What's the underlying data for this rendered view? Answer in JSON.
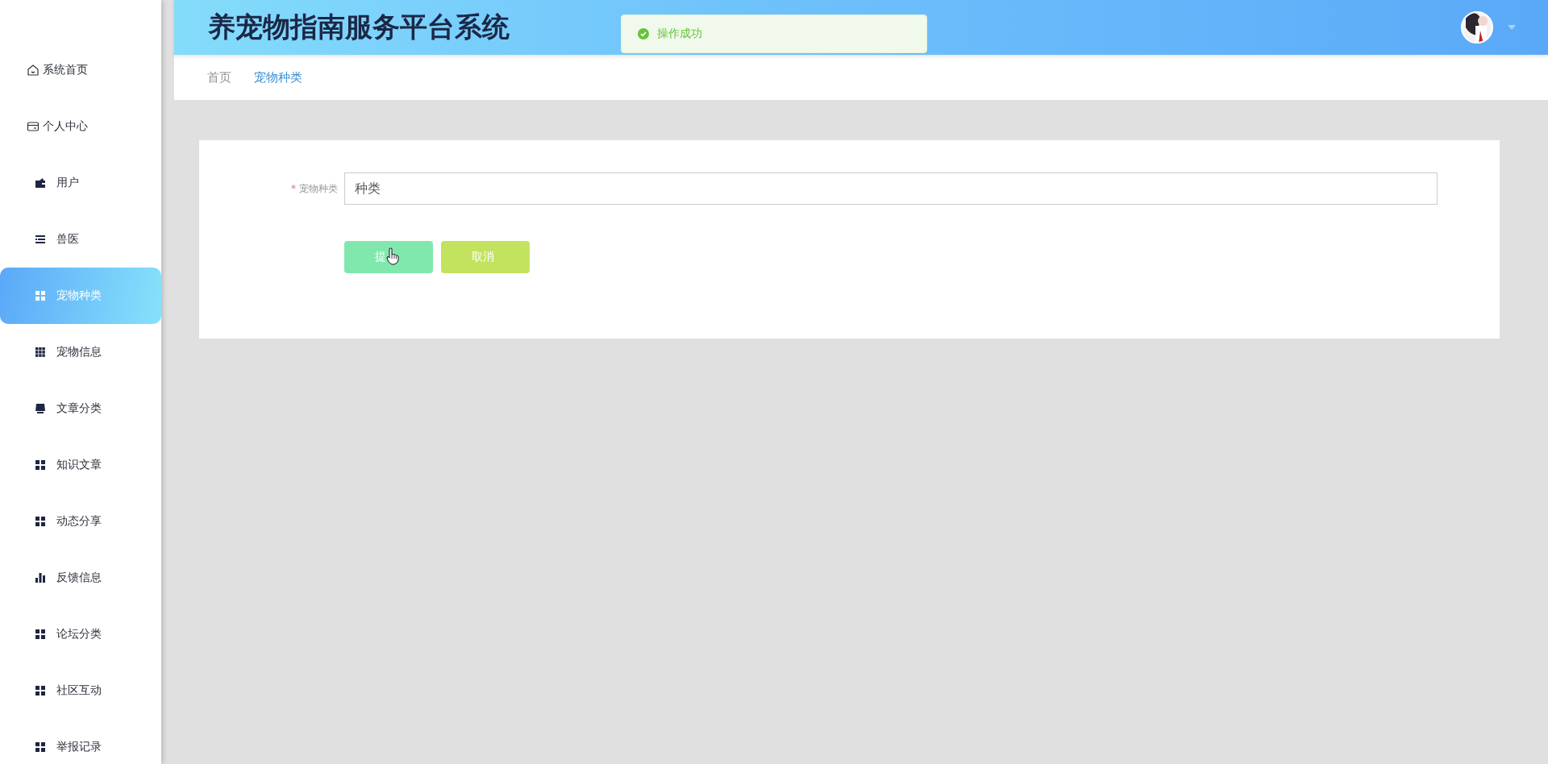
{
  "header": {
    "title": "养宠物指南服务平台系统"
  },
  "toast": {
    "message": "操作成功"
  },
  "breadcrumb": [
    {
      "label": "首页",
      "selected": false
    },
    {
      "label": "宠物种类",
      "selected": true
    }
  ],
  "sidebar": {
    "items": [
      {
        "label": "系统首页",
        "kind": "top",
        "selected": false
      },
      {
        "label": "个人中心",
        "kind": "top",
        "selected": false
      },
      {
        "label": "用户",
        "kind": "menu",
        "selected": false
      },
      {
        "label": "兽医",
        "kind": "menu",
        "selected": false
      },
      {
        "label": "宠物种类",
        "kind": "menu",
        "selected": true
      },
      {
        "label": "宠物信息",
        "kind": "menu",
        "selected": false
      },
      {
        "label": "文章分类",
        "kind": "menu",
        "selected": false
      },
      {
        "label": "知识文章",
        "kind": "menu",
        "selected": false
      },
      {
        "label": "动态分享",
        "kind": "menu",
        "selected": false
      },
      {
        "label": "反馈信息",
        "kind": "menu",
        "selected": false
      },
      {
        "label": "论坛分类",
        "kind": "menu",
        "selected": false
      },
      {
        "label": "社区互动",
        "kind": "menu",
        "selected": false
      },
      {
        "label": "举报记录",
        "kind": "menu",
        "selected": false
      }
    ]
  },
  "form": {
    "field": {
      "label": "宠物种类",
      "required_mark": "*",
      "value": "种类"
    },
    "buttons": [
      {
        "label": "提",
        "kind": "submit"
      },
      {
        "label": "取消",
        "kind": "cancel"
      }
    ]
  }
}
